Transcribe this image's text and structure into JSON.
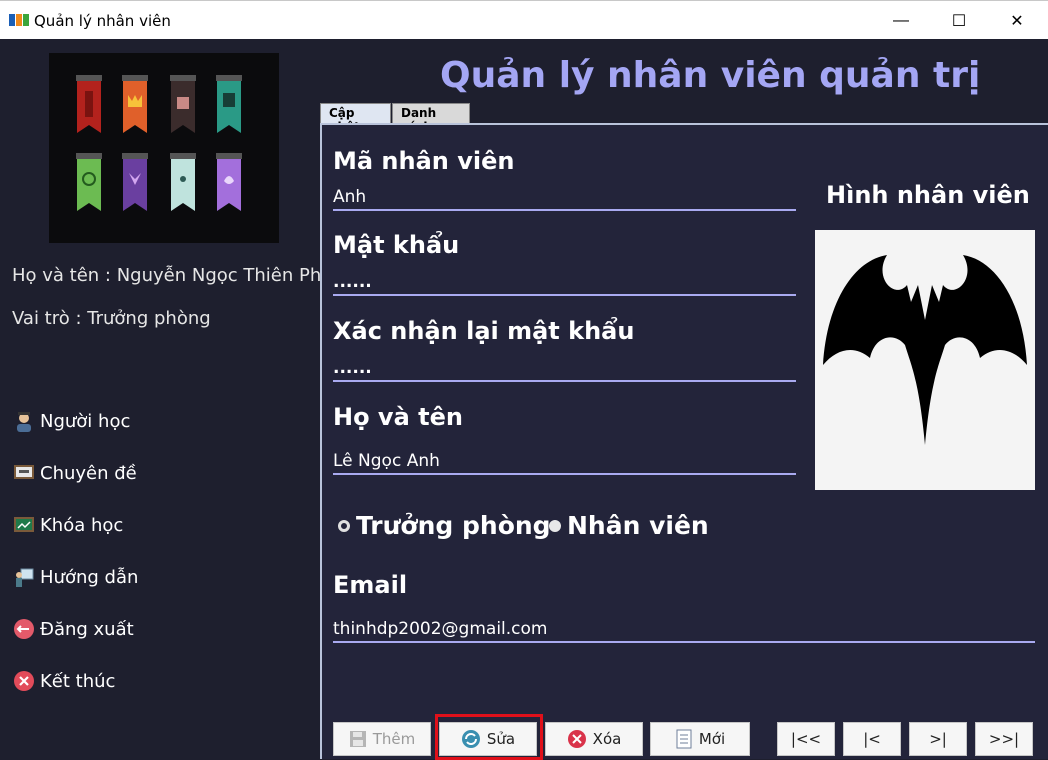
{
  "window": {
    "title": "Quản lý nhân viên",
    "controls": {
      "minimize": "—",
      "maximize": "☐",
      "close": "✕"
    }
  },
  "user": {
    "name_line": "Họ và tên : Nguyễn Ngọc Thiên Phú",
    "role_line": "Vai trò : Trưởng phòng"
  },
  "menu": {
    "items": [
      {
        "label": "Người học",
        "icon": "student-icon"
      },
      {
        "label": "Chuyên đề",
        "icon": "board-icon"
      },
      {
        "label": "Khóa học",
        "icon": "chart-board-icon"
      },
      {
        "label": "Hướng dẫn",
        "icon": "guide-icon"
      },
      {
        "label": "Đăng xuất",
        "icon": "logout-icon"
      },
      {
        "label": "Kết thúc",
        "icon": "exit-icon"
      }
    ]
  },
  "header": {
    "title": "Quản lý nhân viên quản trị"
  },
  "tabs": [
    {
      "label": "Cập nhật",
      "active": true
    },
    {
      "label": "Danh sách",
      "active": false
    }
  ],
  "form": {
    "employee_id": {
      "label": "Mã nhân viên",
      "value": "Anh"
    },
    "password": {
      "label": "Mật khẩu",
      "value": "......"
    },
    "confirm_password": {
      "label": "Xác nhận lại mật khẩu",
      "value": "......"
    },
    "full_name": {
      "label": "Họ và tên",
      "value": "Lê Ngọc Anh"
    },
    "role": {
      "options": [
        "Trưởng phòng",
        "Nhân viên"
      ],
      "selected": "Nhân viên"
    },
    "email": {
      "label": "Email",
      "value": "thinhdp2002@gmail.com"
    },
    "photo_label": "Hình nhân viên"
  },
  "buttons": {
    "add": "Thêm",
    "edit": "Sửa",
    "delete": "Xóa",
    "new": "Mới",
    "first": "|<<",
    "prev": "|<",
    "next": ">|",
    "last": ">>|"
  },
  "colors": {
    "background": "#1e1f2e",
    "accent": "#a4a6f4",
    "highlight": "#e0101a"
  }
}
